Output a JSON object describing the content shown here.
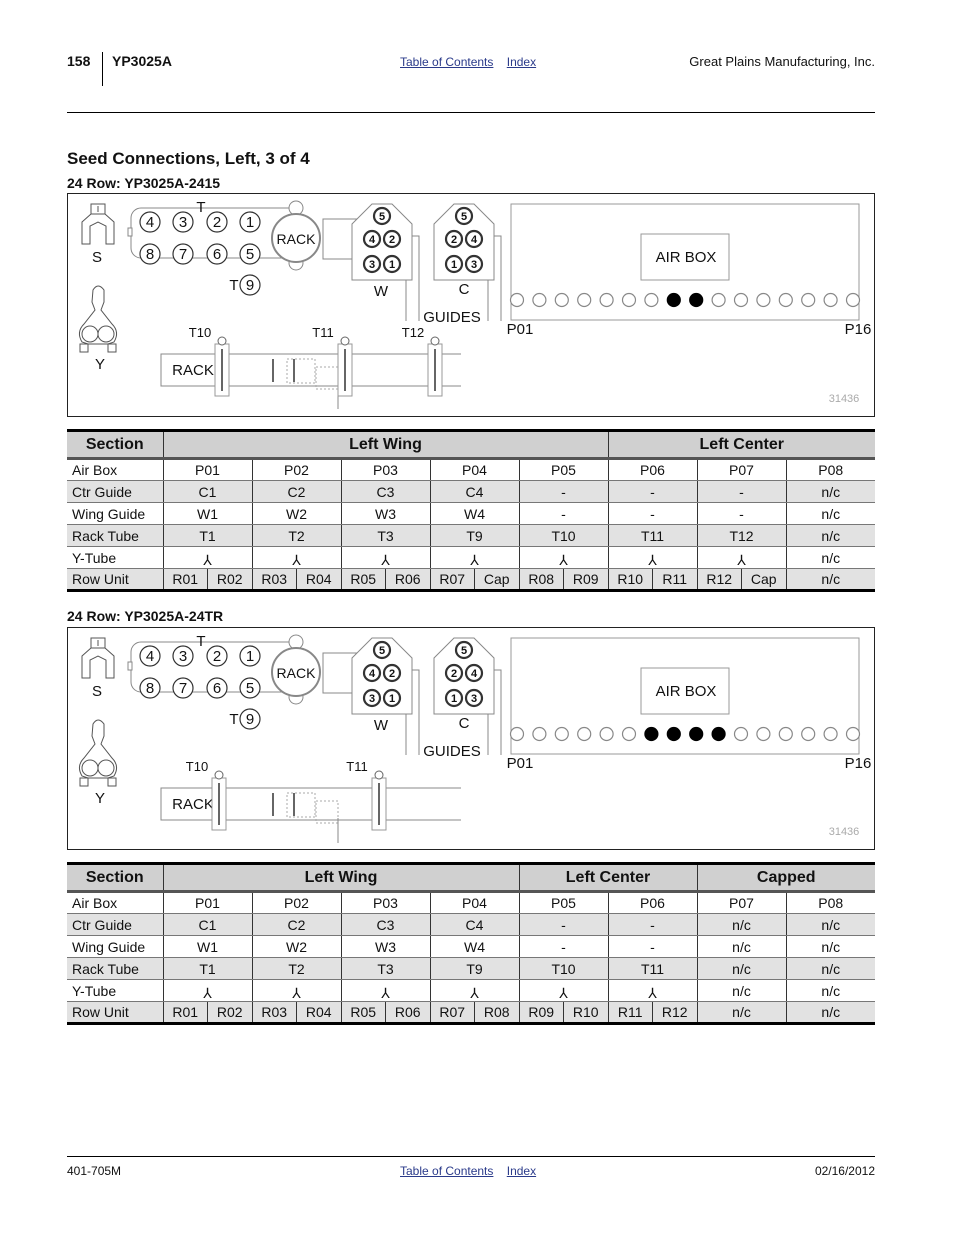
{
  "header": {
    "page_number": "158",
    "document_code": "YP3025A",
    "nav_links": [
      "Table of Contents",
      "Index"
    ],
    "company": "Great Plains Manufacturing, Inc."
  },
  "title": "Seed Connections, Left, 3 of 4",
  "sections": [
    {
      "subtitle": "24 Row: YP3025A-2415",
      "diagram": {
        "labels": {
          "s_tube": "S",
          "y_tube": "Y",
          "t_label": "T",
          "t9_label": "T",
          "rack": "RACK",
          "rack_bar": "RACK",
          "wing_guide": "W",
          "ctr_guide": "C",
          "guides": "GUIDES",
          "air_box": "AIR BOX",
          "port_first": "P01",
          "port_last": "P16",
          "figure_number": "31436"
        },
        "rack_ports_top": [
          "4",
          "3",
          "2",
          "1"
        ],
        "rack_ports_bottom": [
          "8",
          "7",
          "6",
          "5"
        ],
        "rack_port_extra": "9",
        "wing_guide_ports": [
          "5",
          "4",
          "2",
          "3",
          "1"
        ],
        "ctr_guide_ports": [
          "5",
          "2",
          "4",
          "1",
          "3"
        ],
        "rack_tubes": [
          "T10",
          "T11",
          "T12"
        ],
        "air_box_port_count": 16,
        "air_box_ports_filled": [
          8,
          9
        ]
      },
      "table": {
        "headers": [
          {
            "label": "Section"
          },
          {
            "label": "Left Wing",
            "span": 5
          },
          {
            "label": "Left Center",
            "span": 3
          }
        ],
        "rows": [
          {
            "label": "Air Box",
            "cells": [
              "P01",
              "P02",
              "P03",
              "P04",
              "P05",
              "P06",
              "P07",
              "P08"
            ]
          },
          {
            "label": "Ctr Guide",
            "cells": [
              "C1",
              "C2",
              "C3",
              "C4",
              "-",
              "-",
              "-",
              "n/c"
            ]
          },
          {
            "label": "Wing Guide",
            "cells": [
              "W1",
              "W2",
              "W3",
              "W4",
              "-",
              "-",
              "-",
              "n/c"
            ]
          },
          {
            "label": "Rack Tube",
            "cells": [
              "T1",
              "T2",
              "T3",
              "T9",
              "T10",
              "T11",
              "T12",
              "n/c"
            ]
          },
          {
            "label": "Y-Tube",
            "cells": [
              "⅄",
              "⅄",
              "⅄",
              "⅄",
              "⅄",
              "⅄",
              "⅄",
              "n/c"
            ]
          },
          {
            "label": "Row Unit",
            "cells": [
              [
                "R01",
                "R02"
              ],
              [
                "R03",
                "R04"
              ],
              [
                "R05",
                "R06"
              ],
              [
                "R07",
                "Cap"
              ],
              [
                "R08",
                "R09"
              ],
              [
                "R10",
                "R11"
              ],
              [
                "R12",
                "Cap"
              ],
              "n/c"
            ]
          }
        ]
      }
    },
    {
      "subtitle": "24 Row: YP3025A-24TR",
      "diagram": {
        "labels": {
          "s_tube": "S",
          "y_tube": "Y",
          "t_label": "T",
          "t9_label": "T",
          "rack": "RACK",
          "rack_bar": "RACK",
          "wing_guide": "W",
          "ctr_guide": "C",
          "guides": "GUIDES",
          "air_box": "AIR BOX",
          "port_first": "P01",
          "port_last": "P16",
          "figure_number": "31436"
        },
        "rack_ports_top": [
          "4",
          "3",
          "2",
          "1"
        ],
        "rack_ports_bottom": [
          "8",
          "7",
          "6",
          "5"
        ],
        "rack_port_extra": "9",
        "wing_guide_ports": [
          "5",
          "4",
          "2",
          "3",
          "1"
        ],
        "ctr_guide_ports": [
          "5",
          "2",
          "4",
          "1",
          "3"
        ],
        "rack_tubes": [
          "T10",
          "T11"
        ],
        "air_box_port_count": 16,
        "air_box_ports_filled": [
          7,
          8,
          9,
          10
        ]
      },
      "table": {
        "headers": [
          {
            "label": "Section"
          },
          {
            "label": "Left Wing",
            "span": 4
          },
          {
            "label": "Left Center",
            "span": 2
          },
          {
            "label": "Capped",
            "span": 2
          }
        ],
        "rows": [
          {
            "label": "Air Box",
            "cells": [
              "P01",
              "P02",
              "P03",
              "P04",
              "P05",
              "P06",
              "P07",
              "P08"
            ]
          },
          {
            "label": "Ctr Guide",
            "cells": [
              "C1",
              "C2",
              "C3",
              "C4",
              "-",
              "-",
              "n/c",
              "n/c"
            ]
          },
          {
            "label": "Wing Guide",
            "cells": [
              "W1",
              "W2",
              "W3",
              "W4",
              "-",
              "-",
              "n/c",
              "n/c"
            ]
          },
          {
            "label": "Rack Tube",
            "cells": [
              "T1",
              "T2",
              "T3",
              "T9",
              "T10",
              "T11",
              "n/c",
              "n/c"
            ]
          },
          {
            "label": "Y-Tube",
            "cells": [
              "⅄",
              "⅄",
              "⅄",
              "⅄",
              "⅄",
              "⅄",
              "n/c",
              "n/c"
            ]
          },
          {
            "label": "Row Unit",
            "cells": [
              [
                "R01",
                "R02"
              ],
              [
                "R03",
                "R04"
              ],
              [
                "R05",
                "R06"
              ],
              [
                "R07",
                "R08"
              ],
              [
                "R09",
                "R10"
              ],
              [
                "R11",
                "R12"
              ],
              "n/c",
              "n/c"
            ]
          }
        ]
      }
    }
  ],
  "footer": {
    "document_number": "401-705M",
    "nav_links": [
      "Table of Contents",
      "Index"
    ],
    "date": "02/16/2012"
  }
}
